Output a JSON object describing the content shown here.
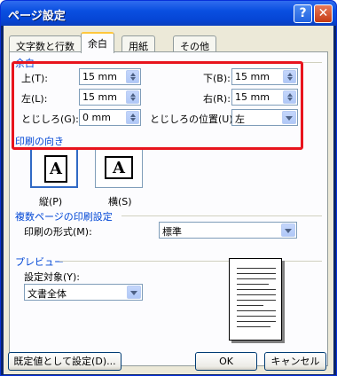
{
  "window": {
    "title": "ページ設定",
    "help_button": "?",
    "close_button": "✕"
  },
  "tabs": [
    {
      "label": "文字数と行数"
    },
    {
      "label": "余白"
    },
    {
      "label": "用紙"
    },
    {
      "label": "その他"
    }
  ],
  "margins": {
    "group_label": "余白",
    "top_label": "上(T):",
    "top_value": "15 mm",
    "bottom_label": "下(B):",
    "bottom_value": "15 mm",
    "left_label": "左(L):",
    "left_value": "15 mm",
    "right_label": "右(R):",
    "right_value": "15 mm",
    "gutter_label": "とじしろ(G):",
    "gutter_value": "0 mm",
    "gutter_pos_label": "とじしろの位置(U):",
    "gutter_pos_value": "左"
  },
  "orientation": {
    "group_label": "印刷の向き",
    "portrait_label": "縦(P)",
    "landscape_label": "横(S)",
    "icon_letter": "A"
  },
  "multipage": {
    "group_label": "複数ページの印刷設定",
    "format_label": "印刷の形式(M):",
    "format_value": "標準"
  },
  "preview": {
    "group_label": "プレビュー",
    "apply_label": "設定対象(Y):",
    "apply_value": "文書全体"
  },
  "buttons": {
    "default": "既定値として設定(D)...",
    "ok": "OK",
    "cancel": "キャンセル"
  },
  "colors": {
    "accent_title": "#0a4fe0",
    "group_label": "#0046d5",
    "highlight_box": "#e8141d"
  }
}
